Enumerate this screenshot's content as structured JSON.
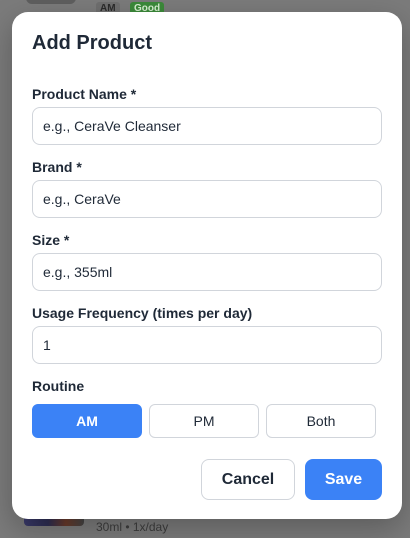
{
  "background": {
    "top_item": {
      "routine_tag": "AM",
      "status_tag": "Good"
    },
    "bottom_item": {
      "meta": "30ml • 1x/day"
    }
  },
  "modal": {
    "title": "Add Product",
    "fields": {
      "product_name": {
        "label": "Product Name *",
        "placeholder": "e.g., CeraVe Cleanser",
        "value": ""
      },
      "brand": {
        "label": "Brand *",
        "placeholder": "e.g., CeraVe",
        "value": ""
      },
      "size": {
        "label": "Size *",
        "placeholder": "e.g., 355ml",
        "value": ""
      },
      "usage_frequency": {
        "label": "Usage Frequency (times per day)",
        "value": "1"
      }
    },
    "routine": {
      "label": "Routine",
      "options": [
        "AM",
        "PM",
        "Both"
      ],
      "selected": "AM"
    },
    "actions": {
      "cancel_label": "Cancel",
      "save_label": "Save"
    }
  },
  "colors": {
    "accent": "#3b82f6",
    "good_badge": "#3c8a3a"
  }
}
